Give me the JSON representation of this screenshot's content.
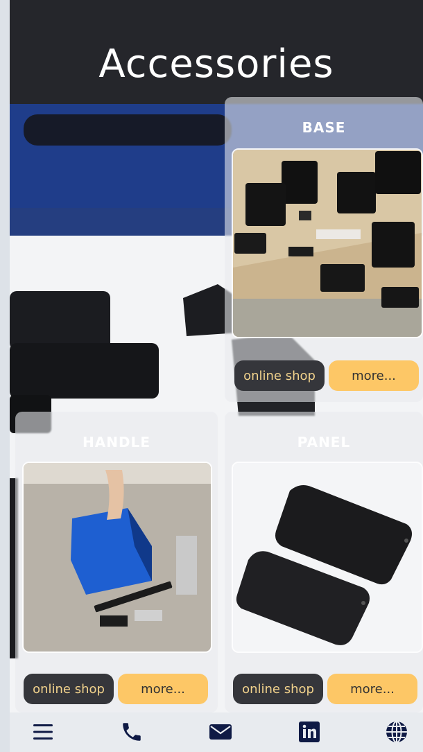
{
  "header": {
    "title": "Accessories"
  },
  "cards": [
    {
      "title": "BASE",
      "shop_label": "online shop",
      "more_label": "more..."
    },
    {
      "title": "HANDLE",
      "shop_label": "online shop",
      "more_label": "more..."
    },
    {
      "title": "PANEL",
      "shop_label": "online shop",
      "more_label": "more..."
    }
  ],
  "bottom_nav": [
    {
      "icon": "menu-icon"
    },
    {
      "icon": "phone-icon"
    },
    {
      "icon": "mail-icon"
    },
    {
      "icon": "linkedin-icon"
    },
    {
      "icon": "globe-icon"
    }
  ],
  "colors": {
    "header": "#25262b",
    "shop_button": "#35363b",
    "shop_text": "#f1d28c",
    "more_button": "#fdc766"
  }
}
